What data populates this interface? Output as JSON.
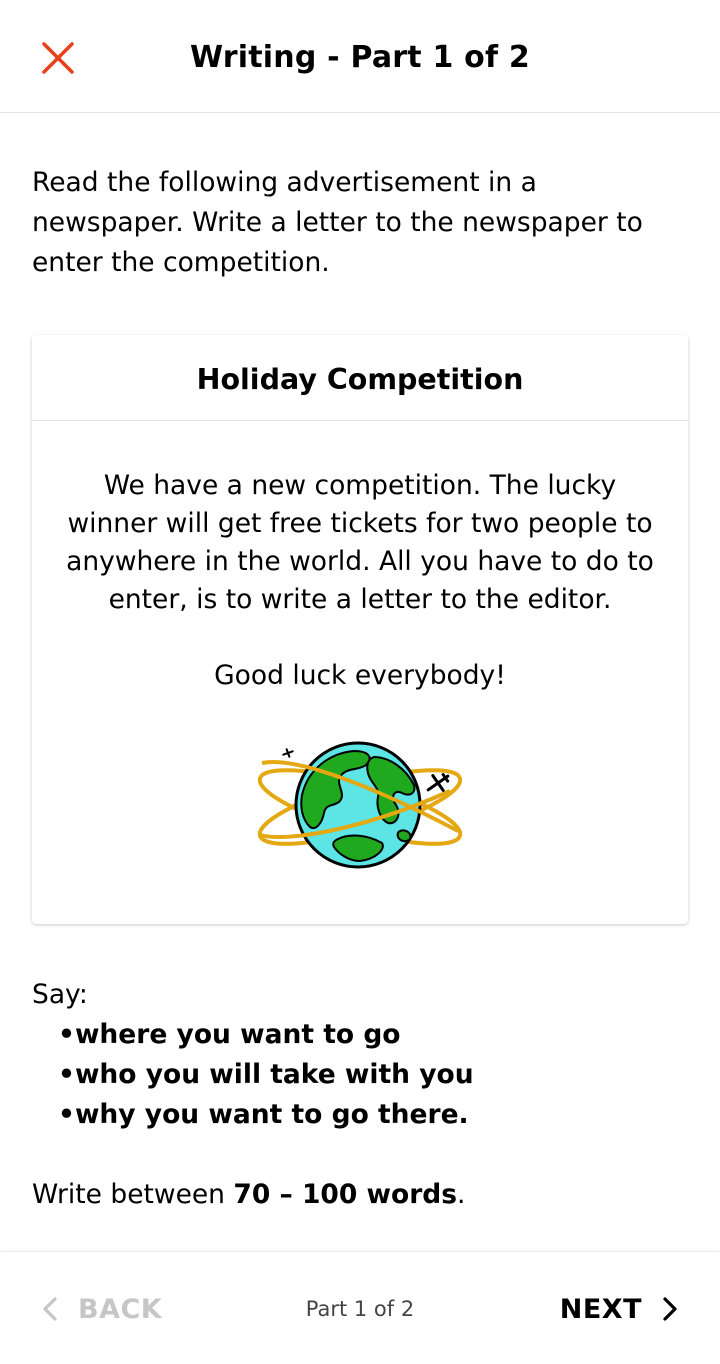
{
  "header": {
    "close_icon": "close-icon",
    "title": "Writing - Part 1 of 2",
    "accent_color": "#e8401c"
  },
  "instructions": "Read the following advertisement in a newspaper. Write a letter to the newspaper to enter the competition.",
  "card": {
    "title": "Holiday Competition",
    "body": "We have a new competition. The lucky winner will get free tickets for two people to anywhere in the world. All you have to do to enter, is to write a letter to the editor.",
    "closing": "Good luck everybody!",
    "image": "globe-with-airplanes-icon"
  },
  "say": {
    "label": "Say:",
    "points": [
      "where you want to go",
      "who you will take with you",
      "why you want to go there."
    ]
  },
  "word_count": {
    "prefix": "Write between ",
    "range": "70 – 100 words",
    "suffix": "."
  },
  "footer": {
    "back_label": "BACK",
    "page_indicator": "Part 1 of 2",
    "next_label": "NEXT"
  }
}
